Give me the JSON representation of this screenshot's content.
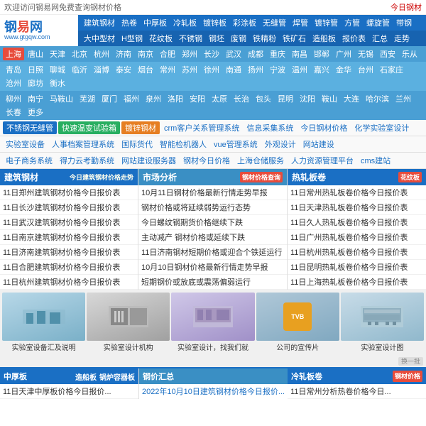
{
  "topbar": {
    "welcome": "欢迎访问钢易网免费查询钢材价格",
    "today": "今日钢材"
  },
  "logo": {
    "name": "钢易网",
    "url": "www.gtgqw.com"
  },
  "nav": {
    "row1": [
      "建筑钢材",
      "热卷",
      "中厚板",
      "冷轧板",
      "镀锌板",
      "彩涂板",
      "无缝管",
      "焊管",
      "镀锌管",
      "方管",
      "螺旋管",
      "带钢"
    ],
    "row2": [
      "大中型材",
      "H型钢",
      "花纹板",
      "不锈钢",
      "钢坯",
      "废钢",
      "铁精粉",
      "铁矿石",
      "造船板",
      "报价表",
      "汇总",
      "走势"
    ]
  },
  "cities1": [
    "上海",
    "唐山",
    "天津",
    "北京",
    "杭州",
    "济南",
    "南京",
    "合肥",
    "郑州",
    "长沙",
    "武汉",
    "成都",
    "重庆",
    "南昌",
    "邯郸",
    "广州",
    "无锡",
    "西安",
    "乐从"
  ],
  "cities2": [
    "青岛",
    "日照",
    "聊城",
    "临沂",
    "淄博",
    "泰安",
    "烟台",
    "常州",
    "苏州",
    "徐州",
    "南通",
    "扬州",
    "宁波",
    "温州",
    "嘉兴",
    "金华",
    "台州",
    "石家庄",
    "沧州",
    "廊坊",
    "衡水"
  ],
  "cities3": [
    "柳州",
    "南宁",
    "马鞍山",
    "芜湖",
    "厦门",
    "福州",
    "泉州",
    "洛阳",
    "安阳",
    "太原",
    "长治",
    "包头",
    "昆明",
    "沈阳",
    "鞍山",
    "大连",
    "哈尔滨",
    "兰州",
    "长春",
    "更多"
  ],
  "quicklinks": [
    {
      "label": "不锈钢无缝管",
      "color": "blue"
    },
    {
      "label": "快速温变试验箱",
      "color": "green"
    },
    {
      "label": "镀锌钢材",
      "color": "orange"
    },
    {
      "label": "crm客户关系管理系统",
      "color": "blue"
    },
    {
      "label": "信息采集系统",
      "color": "blue"
    },
    {
      "label": "今日钢材价格",
      "color": "blue"
    },
    {
      "label": "化学实验室设计",
      "color": "blue"
    },
    {
      "label": "实验室设备",
      "color": "blue"
    },
    {
      "label": "人事档案管理系统",
      "color": "blue"
    },
    {
      "label": "国际货代",
      "color": "blue"
    },
    {
      "label": "智能检机器人",
      "color": "blue"
    },
    {
      "label": "vue管理系统",
      "color": "blue"
    },
    {
      "label": "外观设计",
      "color": "blue"
    },
    {
      "label": "网站建设",
      "color": "blue"
    },
    {
      "label": "电子商务系统",
      "color": "blue"
    },
    {
      "label": "得力云考勤系统",
      "color": "blue"
    },
    {
      "label": "网站建设服务器",
      "color": "blue"
    },
    {
      "label": "钢材今日价格",
      "color": "blue"
    },
    {
      "label": "上海仓储服务",
      "color": "blue"
    },
    {
      "label": "人力资源管理平台",
      "color": "blue"
    },
    {
      "label": "cms建站",
      "color": "blue"
    }
  ],
  "sections": {
    "jianzhu": {
      "title": "建筑钢材",
      "subtitle": "今日建筑钢材价格走势",
      "tag": "市场分析",
      "news": [
        "11日郑州建筑钢材价格今日报价表",
        "11日长沙建筑钢材价格今日报价表",
        "11日武汉建筑钢材价格今日报价表",
        "11日南京建筑钢材价格今日报价表",
        "11日济南建筑钢材价格今日报价表",
        "11日合肥建筑钢材价格今日报价表",
        "11日杭州建筑钢材价格今日报价表"
      ]
    },
    "shichang": {
      "title": "市场分析",
      "news": [
        "10月11日钢材价格最新行情走势早报",
        "钢材价格或将延续弱势运行态势",
        "今日螺纹钢期货价格继续下跌",
        "主动减产 钢材价格或延续下跌",
        "11日济南钢材短期价格或迎合个铁延运行",
        "10月10日钢材价格最新行情走势早报",
        "短期钢价或放底或震荡偏弱运行"
      ]
    },
    "reluan": {
      "title": "热轧板卷",
      "tag": "花纹板",
      "news": [
        "11日常州热轧板卷价格今日报价表",
        "11日天津热轧板卷价格今日报价表",
        "11日久人热轧板卷价格今日报价表",
        "11日广州热轧板卷价格今日报价表",
        "11日杭州热轧板卷价格今日报价表",
        "11日昆明热轧板卷价格今日报价表",
        "11日上海热轧板卷价格今日报价表"
      ]
    }
  },
  "gallery": [
    {
      "caption": "实验室设备汇及说明",
      "color": "#c8dde8"
    },
    {
      "caption": "实验室设计机构",
      "color": "#d0d0d0"
    },
    {
      "caption": "实验室设计，找我们就",
      "color": "#c0b8d8"
    },
    {
      "caption": "公司的宣传片",
      "color": "#b8c8d8"
    },
    {
      "caption": "实验室设计图",
      "color": "#c8dce8"
    }
  ],
  "bottom": {
    "zhonghou": {
      "title": "中厚板",
      "links": [
        "造船板",
        "锅炉容器板"
      ],
      "tag": "钢价汇总",
      "news": [
        "11日天津中厚板价格今日报价..."
      ]
    },
    "lengjia": {
      "title": "冷轧板卷",
      "tag": "钢材价格",
      "news": [
        "11日常州分析热卷价格今日..."
      ]
    }
  }
}
